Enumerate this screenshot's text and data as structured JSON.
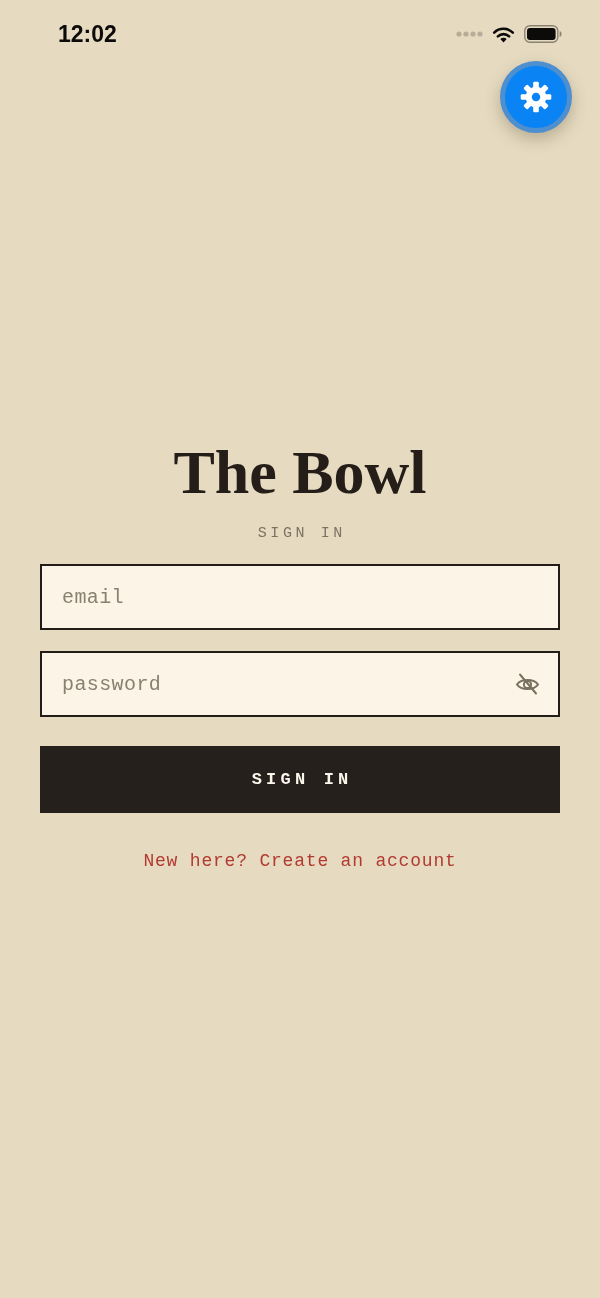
{
  "status_bar": {
    "time": "12:02"
  },
  "title": "The Bowl",
  "subtitle": "SIGN IN",
  "fields": [
    {
      "kind": "email",
      "placeholder": "email"
    },
    {
      "kind": "password",
      "placeholder": "password"
    }
  ],
  "submit_button": {
    "label": "SIGN IN"
  },
  "signup_link": {
    "text": "New here? Create an account"
  }
}
